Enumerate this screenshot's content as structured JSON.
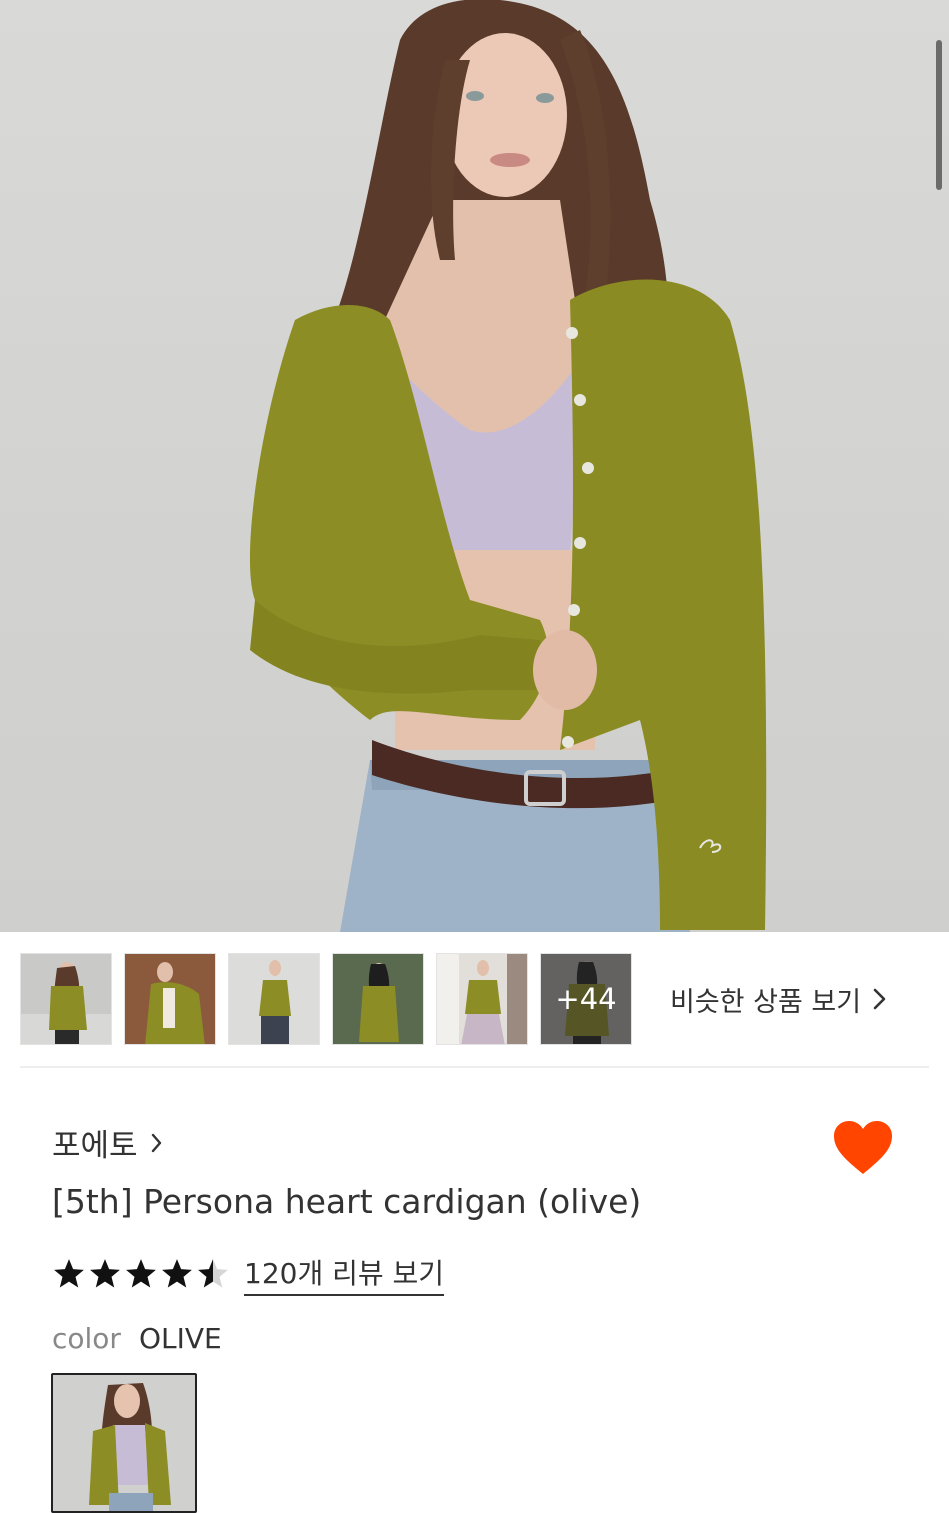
{
  "gallery": {
    "main_image_label": "olive-cardigan-model-photo",
    "thumbnail_count_visible": 6,
    "more_count_label": "+44",
    "similar_link_label": "비슷한 상품 보기"
  },
  "product": {
    "brand": "포에토",
    "name": "[5th] Persona heart cardigan (olive)",
    "rating": 4.5,
    "rating_max": 5,
    "review_link_label": "120개 리뷰 보기",
    "wishlisted": true,
    "color_label": "color",
    "color_value": "OLIVE"
  },
  "colors": {
    "accent_heart": "#ff4500",
    "olive": "#8c8d24",
    "text": "#333333"
  },
  "icons": {
    "brand_chevron": "chevron-right-icon",
    "similar_chevron": "chevron-right-icon",
    "wishlist": "heart-icon",
    "star": "star-icon"
  }
}
